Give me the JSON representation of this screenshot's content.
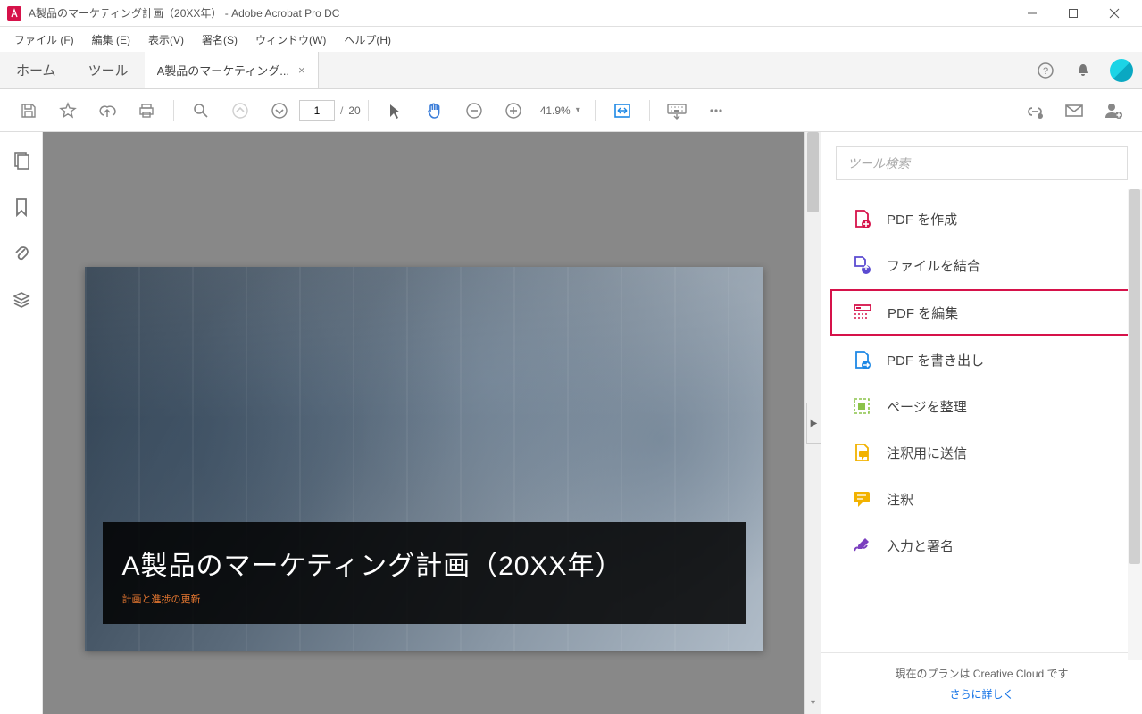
{
  "titlebar": {
    "title": "A製品のマーケティング計画（20XX年）  - Adobe Acrobat Pro DC"
  },
  "menubar": {
    "items": [
      "ファイル (F)",
      "編集 (E)",
      "表示(V)",
      "署名(S)",
      "ウィンドウ(W)",
      "ヘルプ(H)"
    ]
  },
  "tabs": {
    "home": "ホーム",
    "tools": "ツール",
    "document": {
      "label": "A製品のマーケティング...",
      "close": "×"
    }
  },
  "toolbar": {
    "page_current": "1",
    "page_sep": "/",
    "page_total": "20",
    "zoom": "41.9%"
  },
  "document": {
    "title": "A製品のマーケティング計画（20XX年）",
    "subtitle": "計画と進捗の更新"
  },
  "right_panel": {
    "search_placeholder": "ツール検索",
    "tools": [
      {
        "label": "PDF を作成",
        "color": "#d6124a",
        "selected": false
      },
      {
        "label": "ファイルを結合",
        "color": "#5b4bd1",
        "selected": false
      },
      {
        "label": "PDF を編集",
        "color": "#d6124a",
        "selected": true
      },
      {
        "label": "PDF を書き出し",
        "color": "#1e88e5",
        "selected": false
      },
      {
        "label": "ページを整理",
        "color": "#8bc34a",
        "selected": false
      },
      {
        "label": "注釈用に送信",
        "color": "#f2b200",
        "selected": false
      },
      {
        "label": "注釈",
        "color": "#f2b200",
        "selected": false
      },
      {
        "label": "入力と署名",
        "color": "#7b3fbf",
        "selected": false
      }
    ],
    "footer_text": "現在のプランは Creative Cloud です",
    "footer_link": "さらに詳しく"
  }
}
